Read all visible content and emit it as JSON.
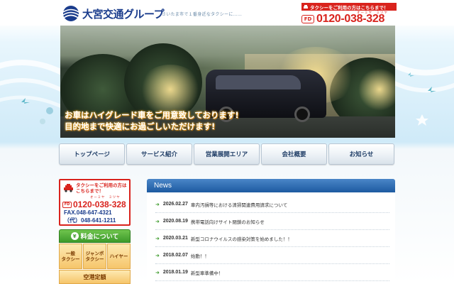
{
  "header": {
    "logo_text": "大宮交通グループ",
    "tagline": "さいたま市で１番身近なタクシーに……",
    "phone_note": "タクシーをご利用の方はこちらまで！",
    "phone_ruby": "オーミヤ　ミツヤ",
    "free_dial": "FD",
    "phone_number": "0120-038-328"
  },
  "hero": {
    "caption_line1": "お車はハイグレード車をご用意致しております!",
    "caption_line2": "目的地まで快適にお過ごしいただけます!"
  },
  "nav": {
    "items": [
      {
        "label": "トップページ"
      },
      {
        "label": "サービス紹介"
      },
      {
        "label": "営業展開エリア"
      },
      {
        "label": "会社概要"
      },
      {
        "label": "お知らせ"
      }
    ]
  },
  "sidebar": {
    "contact_title": "タクシーをご利用の方はこちらまで！",
    "contact_ruby": "オーミヤ　ミツヤ",
    "free_dial": "FD",
    "phone_number": "0120-038-328",
    "fax": "FAX.048-647-4321",
    "tel": "（代）048-641-1211",
    "fare_heading": "料金について",
    "fare_yen": "¥",
    "fare_cells": [
      {
        "label": "一般\nタクシー"
      },
      {
        "label": "ジャンボ\nタクシー"
      },
      {
        "label": "ハイヤー"
      }
    ],
    "airport_label": "空港定額"
  },
  "news": {
    "heading": "News",
    "items": [
      {
        "date": "2026.02.27",
        "title": "車内汚損等における清掃関連費用請求について"
      },
      {
        "date": "2020.08.19",
        "title": "携帯電話向けサイト閉鎖のお知らせ"
      },
      {
        "date": "2020.03.21",
        "title": "新型コロナウイルスの感染対策を始めました！！"
      },
      {
        "date": "2018.02.07",
        "title": "始動！！"
      },
      {
        "date": "2018.01.19",
        "title": "新型車準備中！"
      }
    ]
  }
}
